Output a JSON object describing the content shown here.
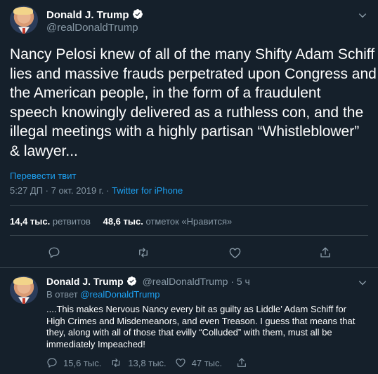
{
  "main_tweet": {
    "author_name": "Donald J. Trump",
    "author_handle": "@realDonaldTrump",
    "text_lines": [
      "Nancy Pelosi knew of all of the many Shifty Adam Schiff",
      "lies and massive frauds perpetrated upon Congress and",
      "the American people, in the form of a fraudulent",
      "speech knowingly delivered as a ruthless con, and the",
      "illegal meetings with a highly partisan “Whistleblower”",
      "& lawyer..."
    ],
    "translate_label": "Перевести твит",
    "timestamp": "5:27 ДП · 7 окт. 2019 г. · ",
    "source": "Twitter for iPhone",
    "retweets_count": "14,4 тыс.",
    "retweets_label": "ретвитов",
    "likes_count": "48,6 тыс.",
    "likes_label": "отметок «Нравится»"
  },
  "reply_tweet": {
    "author_name": "Donald J. Trump",
    "author_handle": "@realDonaldTrump",
    "time_ago": "· 5 ч",
    "reply_prefix": "В ответ",
    "reply_to": "@realDonaldTrump",
    "text_lines": [
      "....This makes Nervous Nancy every bit as guilty as Liddle’ Adam Schiff for",
      "High Crimes and Misdemeanors, and even Treason. I guess that means that",
      "they, along with all of those that evilly “Colluded” with them, must all be",
      "immediately Impeached!"
    ],
    "replies_count": "15,6 тыс.",
    "retweets_count": "13,8 тыс.",
    "likes_count": "47 тыс."
  },
  "icons": {
    "verified": "verified-badge-icon",
    "more": "chevron-down-icon",
    "reply": "reply-icon",
    "retweet": "retweet-icon",
    "like": "heart-icon",
    "share": "share-icon"
  },
  "colors": {
    "background": "#15202b",
    "accent": "#1da1f2",
    "muted": "#8899a6",
    "divider": "#38444d"
  }
}
